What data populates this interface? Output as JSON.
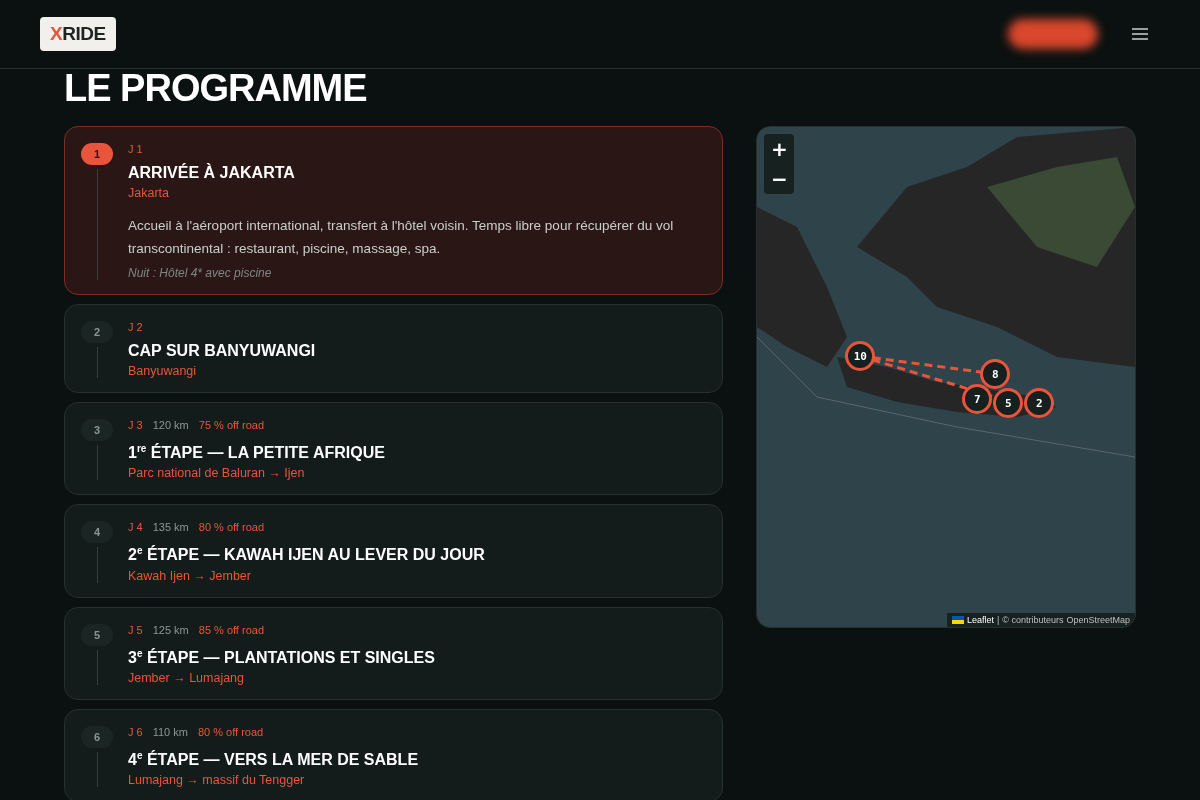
{
  "header": {
    "logo": {
      "accent": "X",
      "rest": "RIDE"
    }
  },
  "page_title": "LE PROGRAMME",
  "days": [
    {
      "number": "1",
      "day": "J 1",
      "title": "ARRIVÉE À JAKARTA",
      "place": "Jakarta",
      "description": "Accueil à l'aéroport international, transfert à l'hôtel voisin. Temps libre pour récupérer du vol transcontinental : restaurant, piscine, massage, spa.",
      "night": "Nuit : Hôtel 4* avec piscine",
      "selected": true
    },
    {
      "number": "2",
      "day": "J 2",
      "title": "CAP SUR BANYUWANGI",
      "place": "Banyuwangi",
      "selected": false
    },
    {
      "number": "3",
      "day": "J 3",
      "distance": "120 km",
      "offroad": "75 % off road",
      "title": "1$^{re}$ ÉTAPE — LA PETITE AFRIQUE",
      "place": "Parc national de Baluran → Ijen",
      "selected": false
    },
    {
      "number": "4",
      "day": "J 4",
      "distance": "135 km",
      "offroad": "80 % off road",
      "title": "2$^{e}$ ÉTAPE — KAWAH IJEN AU LEVER DU JOUR",
      "place": "Kawah Ijen → Jember",
      "selected": false
    },
    {
      "number": "5",
      "day": "J 5",
      "distance": "125 km",
      "offroad": "85 % off road",
      "title": "3$^{e}$ ÉTAPE — PLANTATIONS ET SINGLES",
      "place": "Jember → Lumajang",
      "selected": false
    },
    {
      "number": "6",
      "day": "J 6",
      "distance": "110 km",
      "offroad": "80 % off road",
      "title": "4$^{e}$ ÉTAPE — VERS LA MER DE SABLE",
      "place": "Lumajang → massif du Tengger",
      "selected": false
    }
  ],
  "map": {
    "zoom_in": "+",
    "zoom_out": "−",
    "markers": [
      {
        "label": "10"
      },
      {
        "label": "8"
      },
      {
        "label": "7"
      },
      {
        "label": "5"
      },
      {
        "label": "2"
      }
    ],
    "attribution": {
      "link": "Leaflet",
      "separator": "|",
      "text": "© contributeurs",
      "source": "OpenStreetMap"
    }
  }
}
